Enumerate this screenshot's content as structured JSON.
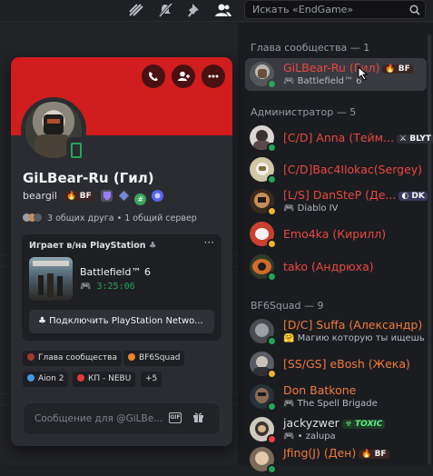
{
  "toolbar": {
    "search_placeholder": "Искать «EndGame»"
  },
  "colors": {
    "banner": "#d11d1d",
    "online": "#23a55a",
    "idle": "#f0b232",
    "dnd": "#f23f43",
    "mention_orange": "#f07a3c",
    "mention_red": "#e8483f"
  },
  "sections": [
    {
      "title": "Глава сообщества — 1"
    },
    {
      "title": "Администратор — 5"
    },
    {
      "title": "BF6Squad — 9"
    }
  ],
  "members": [
    {
      "name": "GiLBear-Ru (Гил)",
      "tag": "BF",
      "sub": "Battlefield™ 6",
      "sub_icon": "gamepad-icon",
      "color": "#e8483f",
      "status": "online"
    },
    {
      "name": "[C/D] Anna (Тейм...",
      "tag": "BLYT",
      "sub": "",
      "color": "#e8483f",
      "status": "online"
    },
    {
      "name": "[C/D]Bac4Ilokac(Sergey)",
      "tag": "",
      "sub": "",
      "color": "#e8483f",
      "status": "online"
    },
    {
      "name": "[L/S] DanSteP (Де...",
      "tag": "DK",
      "sub": "Diablo IV",
      "sub_icon": "gamepad-icon",
      "color": "#e8483f",
      "status": "idle"
    },
    {
      "name": "Emo4ka (Кирилл)",
      "tag": "",
      "sub": "",
      "color": "#e8483f",
      "status": "idle"
    },
    {
      "name": "tako (Андрюха)",
      "tag": "",
      "sub": "",
      "color": "#e8483f",
      "status": "online"
    },
    {
      "name": "[D/C] Suffa (Александр)",
      "tag": "",
      "sub": "Магию которую ты ищешь, на...",
      "sub_icon": "emoji-icon",
      "color": "#f07a3c",
      "status": "online"
    },
    {
      "name": "[SS/GS] eBosh (Жека)",
      "tag": "",
      "sub": "",
      "color": "#f07a3c",
      "status": "idle"
    },
    {
      "name": "Don Batkone",
      "tag": "",
      "sub": "The Spell Brigade",
      "sub_icon": "gamepad-icon",
      "color": "#f07a3c",
      "status": "online"
    },
    {
      "name": "jackyzwer",
      "tag": "TOXIC",
      "sub": "• zalupa",
      "sub_icon": "gamepad-icon",
      "color": "#f07a3c",
      "status": "dnd"
    },
    {
      "name": "Jfing(J) (Ден)",
      "tag": "BF",
      "sub": "",
      "color": "#f07a3c",
      "status": "online"
    }
  ],
  "profile": {
    "display_name": "GiLBear-Ru (Гил)",
    "username": "beargil",
    "user_tag": "BF",
    "mutuals": "3 общих друга • 1 общий сервер",
    "activity": {
      "header": "Играет в/на PlayStation",
      "game": "Battlefield™ 6",
      "elapsed": "3:25:06",
      "connect_label": "Подключить PlayStation Netwo..."
    },
    "roles": [
      {
        "label": "Глава сообщества",
        "color": "#a33a2a"
      },
      {
        "label": "BF6Squad",
        "color": "#f0852b"
      },
      {
        "label": "Aion 2",
        "color": "#3b9be8"
      },
      {
        "label": "КП - NEBU",
        "color": "#e53939"
      }
    ],
    "roles_more": "+5",
    "message_placeholder": "Сообщение для @GiLBe..."
  }
}
